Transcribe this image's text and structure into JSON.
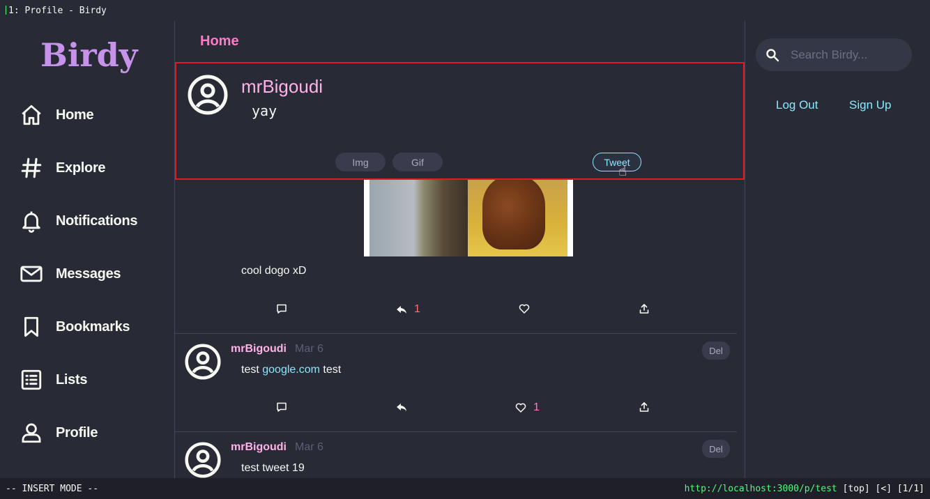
{
  "window": {
    "title": "1: Profile - Birdy"
  },
  "sidebar": {
    "logo": "Birdy",
    "items": [
      {
        "label": "Home",
        "icon": "home-icon"
      },
      {
        "label": "Explore",
        "icon": "hash-icon"
      },
      {
        "label": "Notifications",
        "icon": "bell-icon"
      },
      {
        "label": "Messages",
        "icon": "mail-icon"
      },
      {
        "label": "Bookmarks",
        "icon": "bookmark-icon"
      },
      {
        "label": "Lists",
        "icon": "list-icon"
      },
      {
        "label": "Profile",
        "icon": "user-icon"
      }
    ]
  },
  "main": {
    "title": "Home",
    "composer": {
      "username": "mrBigoudi",
      "text": "yay",
      "img_label": "Img",
      "gif_label": "Gif",
      "tweet_label": "Tweet"
    },
    "feed": [
      {
        "text": "cool dogo xD",
        "actions": {
          "retweets": "1"
        }
      },
      {
        "username": "mrBigoudi",
        "date": "Mar 6",
        "text_before": "test",
        "link": "google.com",
        "text_after": "test",
        "del_label": "Del",
        "actions": {
          "likes": "1"
        }
      },
      {
        "username": "mrBigoudi",
        "date": "Mar 6",
        "text": "test tweet 19",
        "del_label": "Del"
      }
    ]
  },
  "right": {
    "search": {
      "placeholder": "Search Birdy..."
    },
    "logout_label": "Log Out",
    "signup_label": "Sign Up"
  },
  "statusbar": {
    "mode": "-- INSERT MODE --",
    "url": "http://localhost:3000/p/test",
    "position": "[top] [<] [1/1]"
  },
  "colors": {
    "background": "#282a36",
    "accent_pink": "#ff79c6",
    "accent_cyan": "#8be9fd",
    "logo": "#c792ea",
    "highlight_border": "#e01b24"
  }
}
